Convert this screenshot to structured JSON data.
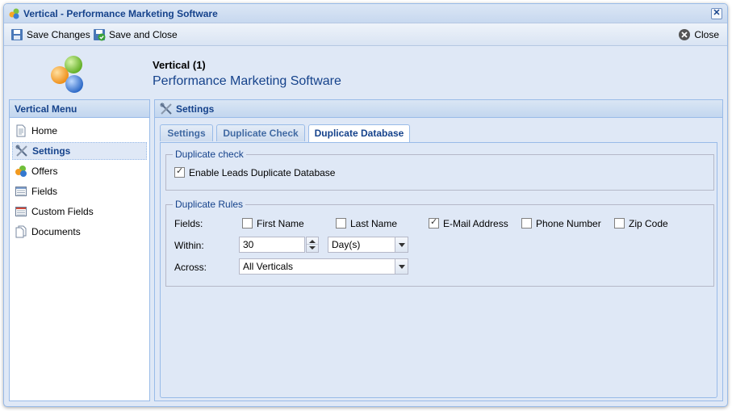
{
  "window": {
    "title": "Vertical - Performance Marketing Software",
    "close_glyph": "✕"
  },
  "toolbar": {
    "save_changes": "Save Changes",
    "save_and_close": "Save and Close",
    "close": "Close"
  },
  "header": {
    "title": "Vertical (1)",
    "subtitle": "Performance Marketing Software"
  },
  "sidebar": {
    "title": "Vertical Menu",
    "selected_index": 1,
    "items": [
      {
        "label": "Home",
        "icon": "page-icon"
      },
      {
        "label": "Settings",
        "icon": "tools-icon"
      },
      {
        "label": "Offers",
        "icon": "offers-icon"
      },
      {
        "label": "Fields",
        "icon": "fields-icon"
      },
      {
        "label": "Custom Fields",
        "icon": "custom-fields-icon"
      },
      {
        "label": "Documents",
        "icon": "documents-icon"
      }
    ]
  },
  "main": {
    "title": "Settings",
    "tabs": [
      {
        "label": "Settings",
        "active": false
      },
      {
        "label": "Duplicate Check",
        "active": false
      },
      {
        "label": "Duplicate Database",
        "active": true
      }
    ],
    "duplicate_check": {
      "legend": "Duplicate check",
      "enable_label": "Enable Leads Duplicate Database",
      "enable_checked": true
    },
    "duplicate_rules": {
      "legend": "Duplicate Rules",
      "fields_label": "Fields:",
      "fields": [
        {
          "label": "First Name",
          "checked": false
        },
        {
          "label": "Last Name",
          "checked": false
        },
        {
          "label": "E-Mail Address",
          "checked": true
        },
        {
          "label": "Phone Number",
          "checked": false
        },
        {
          "label": "Zip Code",
          "checked": false
        }
      ],
      "within_label": "Within:",
      "within_value": "30",
      "within_unit": "Day(s)",
      "across_label": "Across:",
      "across_value": "All Verticals"
    }
  }
}
